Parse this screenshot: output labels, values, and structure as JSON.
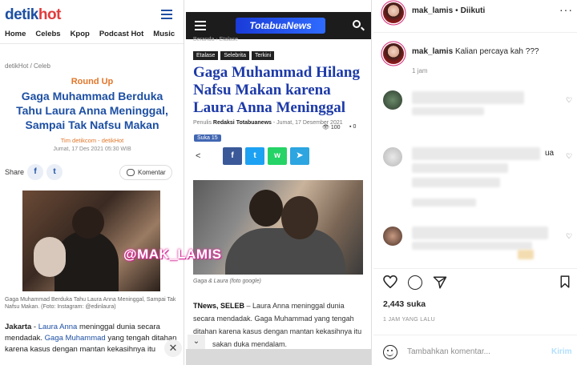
{
  "detik": {
    "logo_main": "detik",
    "logo_hot": "hot",
    "nav": [
      "Home",
      "Celebs",
      "Kpop",
      "Podcast Hot",
      "Music"
    ],
    "breadcrumb": "detikHot / Celeb",
    "kicker": "Round Up",
    "headline": "Gaga Muhammad Berduka Tahu Laura Anna Meninggal, Sampai Tak Nafsu Makan",
    "author": "Tim detikcom - detikHot",
    "date": "Jumat, 17 Des 2021 05:30 WIB",
    "share_label": "Share",
    "comment_label": "Komentar",
    "photo_caption": "Gaga Muhammad Berduka Tahu Laura Anna Meninggal, Sampai Tak Nafsu Makan. (Foto: Instagram: @edinlaura)",
    "body_place": "Jakarta",
    "body_dash": " - ",
    "body_name1": "Laura Anna",
    "body_mid": " meninggal dunia secara mendadak. ",
    "body_name2": "Gaga Muhammad",
    "body_rest": " yang tengah ditahan karena kasus dengan mantan kekasihnya itu",
    "close_label": "✕"
  },
  "watermark": "@MAK_LAMIS",
  "totabua": {
    "brand": "TotabuaNews",
    "breadcrumb": "Beranda  ›  Etalase",
    "tags": [
      "Etalase",
      "Selebrita",
      "Terkini"
    ],
    "title": "Gaga Muhammad Hilang Nafsu Makan karena Laura Anna Meninggal",
    "meta_prefix": "Penulis ",
    "meta_author": "Redaksi Totabuanews",
    "meta_date": " - Jumat, 17 Desember 2021",
    "views": "100",
    "comments": "0",
    "like_btn": "Suka 15",
    "caption": "Gaga & Laura (foto google)",
    "body_lead": "TNews, SELEB",
    "body_text": " – Laura Anna meninggal dunia secara mendadak. Gaga Muhammad yang tengah ditahan karena kasus dengan mantan kekasihnya itu",
    "body_tail": "sakan duka mendalam."
  },
  "instagram": {
    "username": "mak_lamis",
    "dot": "•",
    "follow_status": "Diikuti",
    "caption_user": "mak_lamis",
    "caption_text": "Kalian percaya kah ???",
    "caption_time": "1 jam",
    "comment_partial": "ua",
    "likes": "2,443 suka",
    "posted_ago": "1 JAM YANG LALU",
    "comment_placeholder": "Tambahkan komentar...",
    "post_btn": "Kirim"
  }
}
